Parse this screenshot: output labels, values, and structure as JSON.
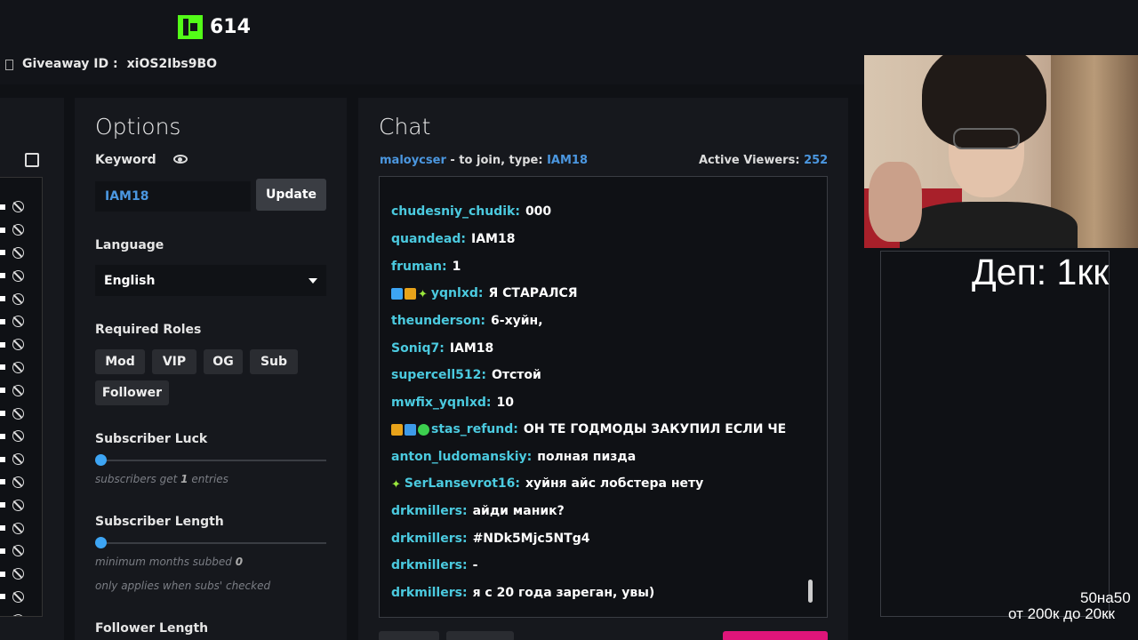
{
  "header": {
    "logo_count": "614",
    "giveaway_label": "Giveaway ID :",
    "giveaway_id": "xiOS2Ibs9BO"
  },
  "options": {
    "title": "Options",
    "keyword_label": "Keyword",
    "keyword_value": "IAM18",
    "update_label": "Update",
    "language_label": "Language",
    "language_value": "English",
    "roles_label": "Required Roles",
    "roles": [
      "Mod",
      "VIP",
      "OG",
      "Sub",
      "Follower"
    ],
    "sub_luck_label": "Subscriber Luck",
    "sub_luck_hint_pre": "subscribers get",
    "sub_luck_hint_num": "1",
    "sub_luck_hint_post": "entries",
    "sub_length_label": "Subscriber Length",
    "sub_length_hint_pre": "minimum months subbed",
    "sub_length_hint_num": "0",
    "sub_length_hint2": "only applies when subs' checked",
    "follower_length_label": "Follower Length"
  },
  "chat": {
    "title": "Chat",
    "join_user": "maloycser",
    "join_text": "- to join, type:",
    "join_keyword": "IAM18",
    "viewers_label": "Active Viewers:",
    "viewers_count": "252",
    "messages": [
      {
        "user": "chudesniy_chudik:",
        "text": "000"
      },
      {
        "user": "quandead:",
        "text": "IAM18"
      },
      {
        "user": "fruman:",
        "text": "1"
      },
      {
        "user": "yqnlxd:",
        "text": "Я СТАРАЛСЯ"
      },
      {
        "user": "theunderson:",
        "text": "6-хуйн,"
      },
      {
        "user": "Soniq7:",
        "text": "IAM18"
      },
      {
        "user": "supercell512:",
        "text": "Отстой"
      },
      {
        "user": "mwfix_yqnlxd:",
        "text": "10"
      },
      {
        "user": "stas_refund:",
        "text": "ОН ТЕ ГОДМОДЫ ЗАКУПИЛ ЕСЛИ ЧЕ"
      },
      {
        "user": "anton_ludomanskiy:",
        "text": "полная пизда"
      },
      {
        "user": "SerLansevrot16:",
        "text": "хуйня айс лобстера нету"
      },
      {
        "user": "drkmillers:",
        "text": "айди маник?"
      },
      {
        "user": "drkmillers:",
        "text": "#NDk5Mjc5NTg4"
      },
      {
        "user": "drkmillers:",
        "text": "-"
      },
      {
        "user": "drkmillers:",
        "text": "я с 20 года зареган, увы)"
      }
    ]
  },
  "overlay": {
    "big_text": "Деп: 1кк",
    "small_line1": "50на50",
    "small_line2": "от 200к до 20кк"
  },
  "colors": {
    "accent_blue": "#4b97e0",
    "username": "#4bcadf",
    "kick_green": "#53fc18",
    "slider": "#3da5f4"
  }
}
